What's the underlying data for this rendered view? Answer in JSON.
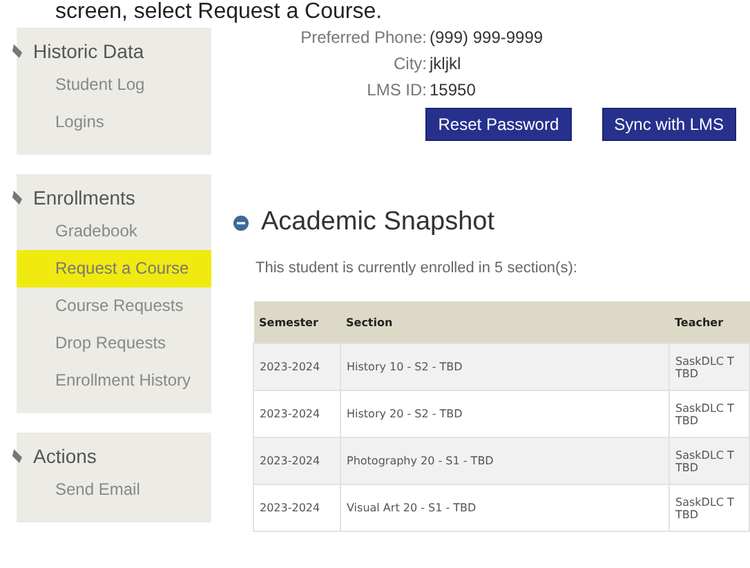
{
  "caption": "screen, select Request a Course.",
  "sidebar": [
    {
      "title": "Historic Data",
      "items": [
        {
          "label": "Student Log",
          "selected": false
        },
        {
          "label": "Logins",
          "selected": false
        }
      ]
    },
    {
      "title": "Enrollments",
      "items": [
        {
          "label": "Gradebook",
          "selected": false
        },
        {
          "label": "Request a Course",
          "selected": true
        },
        {
          "label": "Course Requests",
          "selected": false
        },
        {
          "label": "Drop Requests",
          "selected": false
        },
        {
          "label": "Enrollment History",
          "selected": false
        }
      ]
    },
    {
      "title": "Actions",
      "items": [
        {
          "label": "Send Email",
          "selected": false
        }
      ]
    }
  ],
  "profile": [
    {
      "label": "Preferred Phone:",
      "value": "(999) 999-9999"
    },
    {
      "label": "City:",
      "value": "jkljkl"
    },
    {
      "label": "LMS ID:",
      "value": "15950"
    }
  ],
  "buttons": [
    "Reset Password",
    "Sync with LMS"
  ],
  "snapshot": {
    "title": "Academic Snapshot",
    "subtitle": "This student is currently enrolled in 5 section(s):",
    "table": {
      "columns": [
        "Semester",
        "Section",
        "Teacher"
      ],
      "rows": [
        [
          "2023-2024",
          "History 10 - S2 - TBD",
          [
            "SaskDLC T",
            "TBD"
          ]
        ],
        [
          "2023-2024",
          "History 20 - S2 - TBD",
          [
            "SaskDLC T",
            "TBD"
          ]
        ],
        [
          "2023-2024",
          "Photography 20 - S1 - TBD",
          [
            "SaskDLC T",
            "TBD"
          ]
        ],
        [
          "2023-2024",
          "Visual Art 20 - S1 - TBD",
          [
            "SaskDLC T",
            "TBD"
          ]
        ]
      ]
    }
  }
}
